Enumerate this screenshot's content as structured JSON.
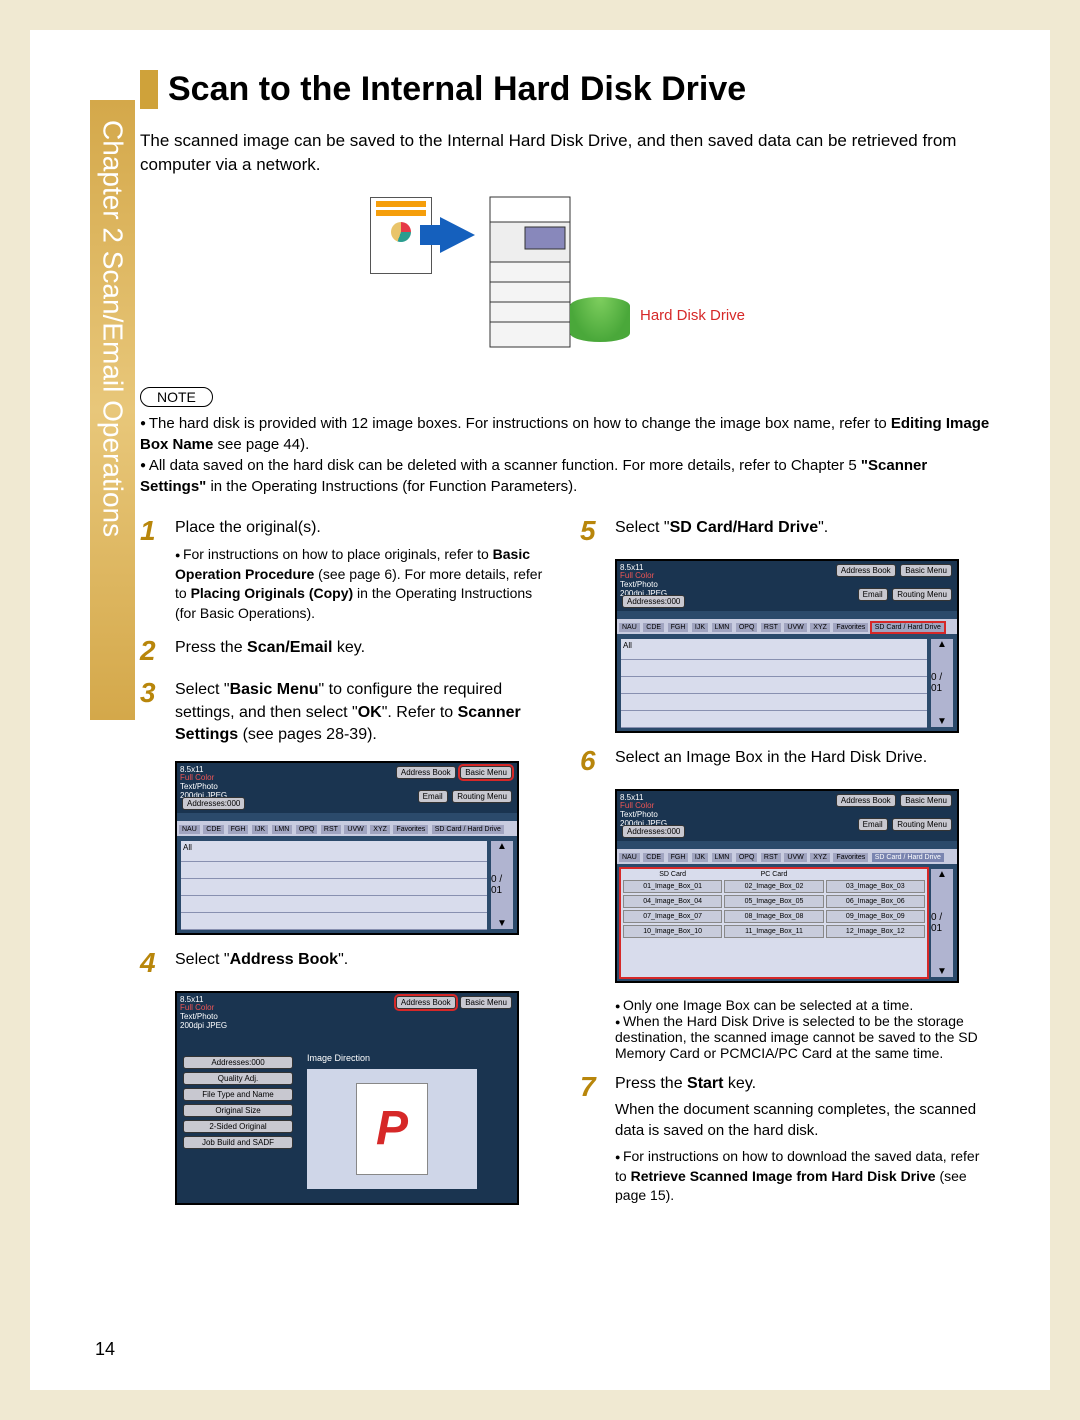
{
  "chapter_tab": "Chapter 2   Scan/Email Operations",
  "title": "Scan to the Internal Hard Disk Drive",
  "intro": "The scanned image can be saved to the Internal Hard Disk Drive, and then saved data can be retrieved from computer via a network.",
  "hdd_label": "Hard Disk Drive",
  "note_label": "NOTE",
  "notes": {
    "n1a": "The hard disk is provided with 12 image boxes. For instructions on how to change the image box name, refer to ",
    "n1b": "Editing Image Box Name",
    "n1c": " see page 44).",
    "n2a": "All data saved on the hard disk can be deleted with a scanner function. For more details, refer to Chapter 5 ",
    "n2b": "\"Scanner Settings\"",
    "n2c": " in the Operating Instructions (for Function Parameters)."
  },
  "steps": {
    "s1": {
      "num": "1",
      "text": "Place the original(s).",
      "sub_a": "For instructions on how to place originals, refer to ",
      "sub_b": "Basic Operation Procedure",
      "sub_c": " (see page 6). For more details, refer to ",
      "sub_d": "Placing Originals (Copy)",
      "sub_e": " in the Operating Instructions (for Basic Operations)."
    },
    "s2": {
      "num": "2",
      "a": "Press the ",
      "b": "Scan/Email",
      "c": " key."
    },
    "s3": {
      "num": "3",
      "a": "Select \"",
      "b": "Basic Menu",
      "c": "\" to configure the required settings, and then select \"",
      "d": "OK",
      "e": "\". Refer to ",
      "f": "Scanner Settings",
      "g": " (see pages 28-39)."
    },
    "s4": {
      "num": "4",
      "a": "Select \"",
      "b": "Address Book",
      "c": "\"."
    },
    "s5": {
      "num": "5",
      "a": "Select \"",
      "b": "SD Card/Hard Drive",
      "c": "\"."
    },
    "s6": {
      "num": "6",
      "text": "Select an Image Box in the Hard Disk Drive.",
      "sub1": "Only one Image Box can be selected at a time.",
      "sub2": "When the Hard Disk Drive is selected to be the storage destination, the scanned image cannot be saved to the SD Memory Card or PCMCIA/PC Card at the same time."
    },
    "s7": {
      "num": "7",
      "a": "Press the ",
      "b": "Start",
      "c": " key.",
      "line2": "When the document scanning completes, the scanned data is saved on the hard disk.",
      "sub_a": "For instructions on how to download the saved data, refer to ",
      "sub_b": "Retrieve Scanned Image from Hard Disk Drive",
      "sub_c": " (see page 15)."
    }
  },
  "screen_common": {
    "size": "8.5x11",
    "mode": "Full Color",
    "type": "Text/Photo",
    "res": "200dpi JPEG",
    "addr_count": "Addresses:000",
    "btn_address": "Address Book",
    "btn_basic": "Basic Menu",
    "btn_email": "Email",
    "btn_routing": "Routing Menu",
    "tabs": [
      "NAU",
      "CDE",
      "FGH",
      "IJK",
      "LMN",
      "OPQ",
      "RST",
      "UVW",
      "XYZ",
      "Favorites"
    ],
    "sd_tab": "SD Card / Hard Drive",
    "all_row": "All",
    "scroll_mid": "0 / 01"
  },
  "screen_ab": {
    "img_dir": "Image Direction",
    "menu": [
      "Addresses:000",
      "Quality Adj.",
      "File Type and Name",
      "Original Size",
      "2-Sided Original",
      "Job Build and SADF"
    ],
    "preview_letter": "P"
  },
  "screen_boxes": {
    "hdr_sd": "SD Card",
    "hdr_pc": "PC Card",
    "boxes": [
      "01_Image_Box_01",
      "02_Image_Box_02",
      "03_Image_Box_03",
      "04_Image_Box_04",
      "05_Image_Box_05",
      "06_Image_Box_06",
      "07_Image_Box_07",
      "08_Image_Box_08",
      "09_Image_Box_09",
      "10_Image_Box_10",
      "11_Image_Box_11",
      "12_Image_Box_12"
    ]
  },
  "page_number": "14"
}
